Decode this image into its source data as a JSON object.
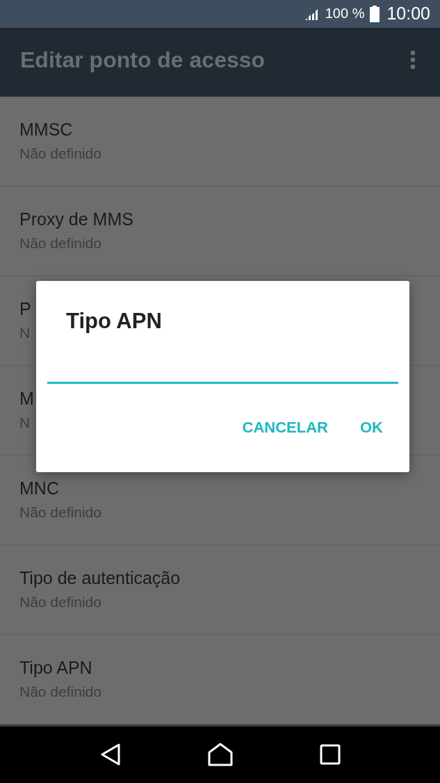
{
  "status_bar": {
    "battery": "100 %",
    "time": "10:00"
  },
  "app_bar": {
    "title": "Editar ponto de acesso"
  },
  "settings": [
    {
      "title": "MMSC",
      "value": "Não definido"
    },
    {
      "title": "Proxy de MMS",
      "value": "Não definido"
    },
    {
      "title": "P",
      "value": "N"
    },
    {
      "title": "M",
      "value": "N"
    },
    {
      "title": "MNC",
      "value": "Não definido"
    },
    {
      "title": "Tipo de autenticação",
      "value": "Não definido"
    },
    {
      "title": "Tipo APN",
      "value": "Não definido"
    }
  ],
  "dialog": {
    "title": "Tipo APN",
    "field": {
      "focused": true
    },
    "buttons": [
      "CANCELAR",
      "OK"
    ]
  }
}
